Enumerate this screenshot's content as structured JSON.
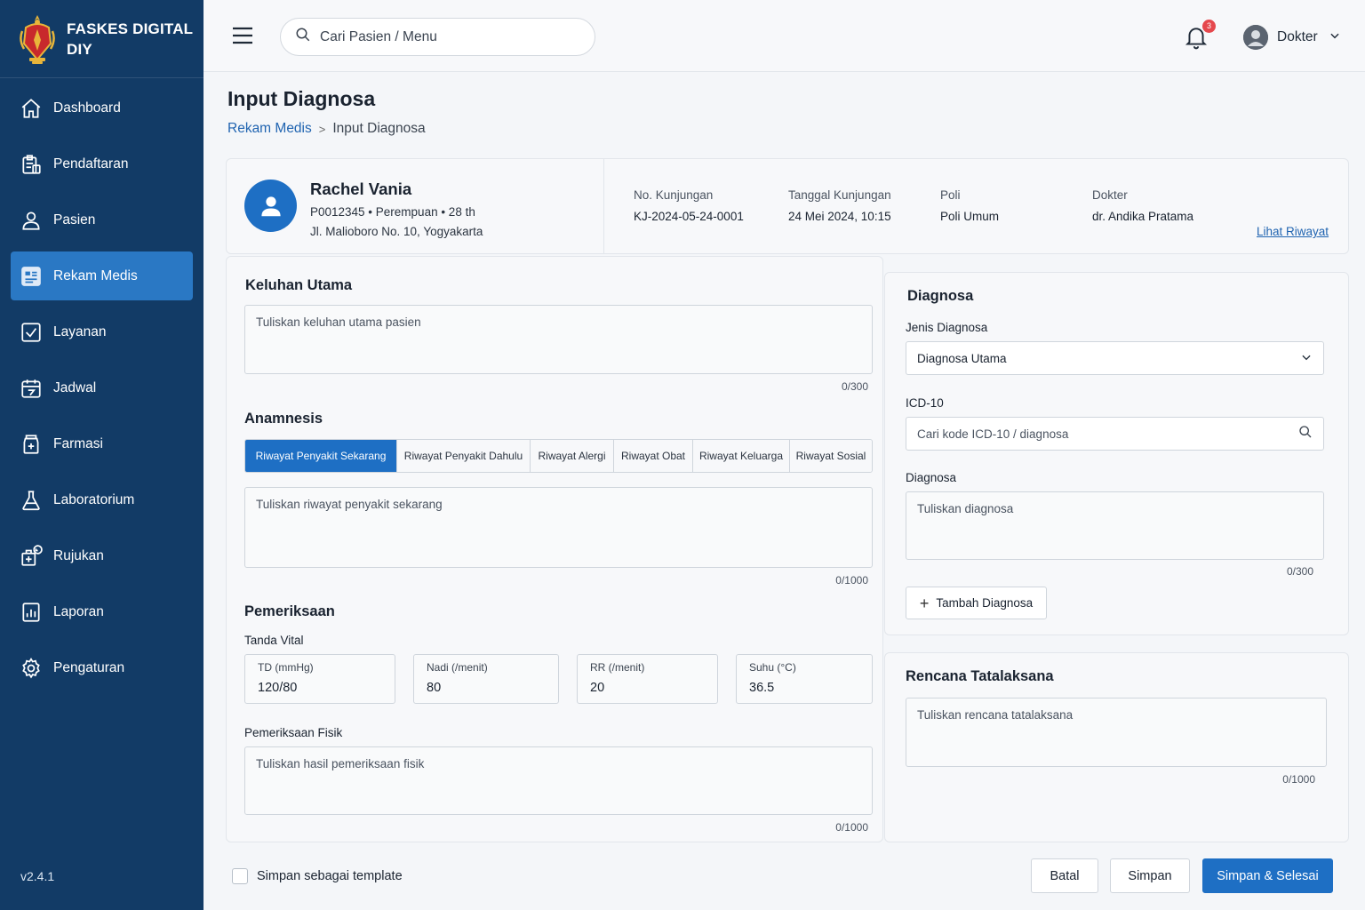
{
  "brand": {
    "title": "FASKES DIGITAL\nDIY"
  },
  "sidebar": {
    "items": [
      {
        "label": "Dashboard",
        "icon": "home-icon"
      },
      {
        "label": "Pendaftaran",
        "icon": "registration-icon"
      },
      {
        "label": "Pasien",
        "icon": "user-icon"
      },
      {
        "label": "Rekam Medis",
        "icon": "medical-record-icon",
        "active": true
      },
      {
        "label": "Layanan",
        "icon": "checklist-icon"
      },
      {
        "label": "Jadwal",
        "icon": "calendar-icon"
      },
      {
        "label": "Farmasi",
        "icon": "pharmacy-icon"
      },
      {
        "label": "Laboratorium",
        "icon": "flask-icon"
      },
      {
        "label": "Rujukan",
        "icon": "referral-icon"
      },
      {
        "label": "Laporan",
        "icon": "report-icon"
      },
      {
        "label": "Pengaturan",
        "icon": "gear-icon"
      }
    ],
    "version": "v2.4.1"
  },
  "topbar": {
    "search_placeholder": "Cari Pasien / Menu",
    "notification_count": "3",
    "user_name": "Dokter"
  },
  "page": {
    "title": "Input Diagnosa",
    "breadcrumb": {
      "parent": "Rekam Medis",
      "current": "Input Diagnosa"
    }
  },
  "patient": {
    "name": "Rachel Vania",
    "meta": "P0012345  •  Perempuan  •  28 th",
    "address": "Jl. Malioboro No. 10, Yogyakarta",
    "visit_no_label": "No. Kunjungan",
    "visit_no": "KJ-2024-05-24-0001",
    "visit_date_label": "Tanggal Kunjungan",
    "visit_date": "24 Mei 2024, 10:15",
    "poli_label": "Poli",
    "poli": "Poli Umum",
    "doctor_label": "Dokter",
    "doctor": "dr. Andika Pratama",
    "history_link": "Lihat Riwayat"
  },
  "keluhan": {
    "title": "Keluhan Utama",
    "placeholder": "Tuliskan keluhan utama pasien",
    "counter": "0/300"
  },
  "anamnesis": {
    "title": "Anamnesis",
    "tabs": [
      "Riwayat Penyakit Sekarang",
      "Riwayat Penyakit Dahulu",
      "Riwayat Alergi",
      "Riwayat Obat",
      "Riwayat Keluarga",
      "Riwayat Sosial"
    ],
    "placeholder": "Tuliskan riwayat penyakit sekarang",
    "counter": "0/1000"
  },
  "pemeriksaan": {
    "title": "Pemeriksaan",
    "vital_title": "Tanda Vital",
    "vitals": [
      {
        "label": "TD (mmHg)",
        "value": "120/80"
      },
      {
        "label": "Nadi (/menit)",
        "value": "80"
      },
      {
        "label": "RR (/menit)",
        "value": "20"
      },
      {
        "label": "Suhu (°C)",
        "value": "36.5"
      }
    ],
    "fisik_title": "Pemeriksaan Fisik",
    "fisik_placeholder": "Tuliskan hasil pemeriksaan fisik",
    "fisik_counter": "0/1000"
  },
  "diagnosa": {
    "title": "Diagnosa",
    "jenis_label": "Jenis Diagnosa",
    "jenis_value": "Diagnosa Utama",
    "icd_label": "ICD-10",
    "icd_placeholder": "Cari kode ICD-10 / diagnosa",
    "diag_label": "Diagnosa",
    "diag_placeholder": "Tuliskan diagnosa",
    "diag_counter": "0/300",
    "add_label": "Tambah Diagnosa"
  },
  "rencana": {
    "title": "Rencana Tatalaksana",
    "placeholder": "Tuliskan rencana tatalaksana",
    "counter": "0/1000"
  },
  "footer": {
    "template_label": "Simpan sebagai template",
    "cancel": "Batal",
    "save": "Simpan",
    "save_finish": "Simpan & Selesai"
  },
  "colors": {
    "sidebar_bg": "#123b66",
    "active_item": "#2a78c4",
    "primary": "#1e6fc4",
    "link": "#1f63b0",
    "badge": "#e5484d"
  }
}
